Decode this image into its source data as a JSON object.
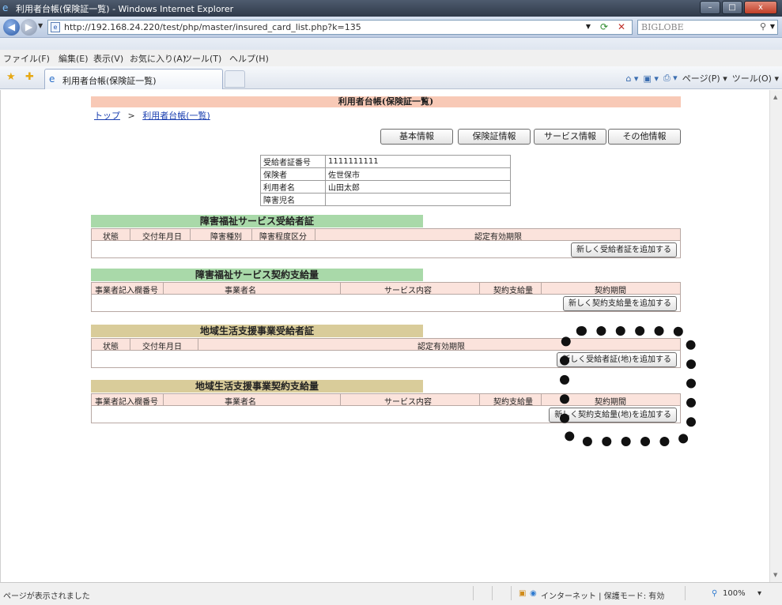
{
  "window": {
    "title": "利用者台帳(保険証一覧) - Windows Internet Explorer",
    "controls": [
      "–",
      "□",
      "x"
    ]
  },
  "address": {
    "url": "http://192.168.24.220/test/php/master/insured_card_list.php?k=135",
    "search_engine": "BIGLOBE"
  },
  "menu": [
    "ファイル(F)",
    "編集(E)",
    "表示(V)",
    "お気に入り(A)",
    "ツール(T)",
    "ヘルプ(H)"
  ],
  "tab": {
    "label": "利用者台帳(保険証一覧)"
  },
  "command_bar": {
    "page": "ページ(P) ▾",
    "tools": "ツール(O) ▾"
  },
  "page": {
    "header": "利用者台帳(保険証一覧)",
    "breadcrumb": {
      "top": "トップ",
      "sep": ">",
      "current": "利用者台帳(一覧)"
    },
    "tabs": [
      "基本情報",
      "保険証情報",
      "サービス情報",
      "その他情報"
    ],
    "info": [
      {
        "key": "受給者証番号",
        "value": "1111111111"
      },
      {
        "key": "保険者",
        "value": "佐世保市"
      },
      {
        "key": "利用者名",
        "value": "山田太郎"
      },
      {
        "key": "障害児名",
        "value": ""
      }
    ],
    "sections": [
      {
        "title": "障害福祉サービス受給者証",
        "columns": [
          "状態",
          "交付年月日",
          "障害種別",
          "障害程度区分",
          "認定有効期限"
        ],
        "button": "新しく受給者証を追加する"
      },
      {
        "title": "障害福祉サービス契約支給量",
        "columns": [
          "事業者記入欄番号",
          "事業者名",
          "サービス内容",
          "契約支給量",
          "契約期間"
        ],
        "button": "新しく契約支給量を追加する"
      },
      {
        "title": "地域生活支援事業受給者証",
        "columns": [
          "状態",
          "交付年月日",
          "認定有効期限"
        ],
        "button": "新しく受給者証(地)を追加する"
      },
      {
        "title": "地域生活支援事業契約支給量",
        "columns": [
          "事業者記入欄番号",
          "事業者名",
          "サービス内容",
          "契約支給量",
          "契約期間"
        ],
        "button": "新しく契約支給量(地)を追加する"
      }
    ]
  },
  "status": {
    "left": "ページが表示されました",
    "zone": "インターネット | 保護モード: 有効",
    "zoom": "100%"
  }
}
